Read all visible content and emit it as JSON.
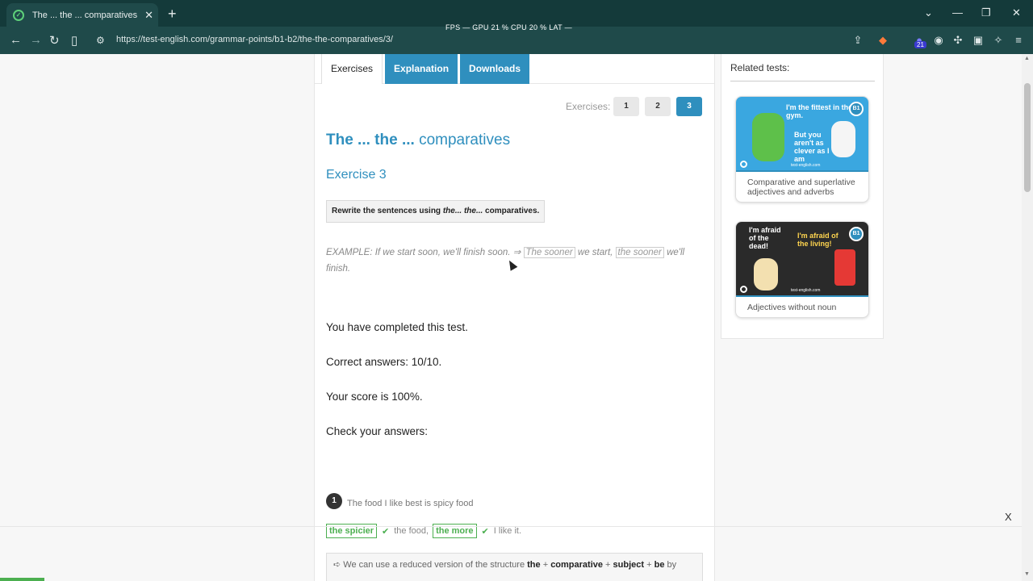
{
  "browser": {
    "tab_title": "The ... the ... comparatives - Pag",
    "tab_close": "✕",
    "new_tab": "+",
    "url": "https://test-english.com/grammar-points/b1-b2/the-the-comparatives/3/",
    "perf_overlay": "FPS  —  GPU 21 % CPU 20 % LAT  —",
    "ext_badge": "21"
  },
  "page_tabs": [
    "Exercises",
    "Explanation",
    "Downloads"
  ],
  "exercises": {
    "label": "Exercises:",
    "numbers": [
      "1",
      "2",
      "3"
    ],
    "current": "3"
  },
  "content": {
    "title_bold": "The ... the ...",
    "title_rest": " comparatives",
    "exercise_heading": "Exercise 3",
    "instruction_pre": "Rewrite the sentences using ",
    "instruction_italic": "the... the...",
    "instruction_post": " comparatives.",
    "example_pre": "EXAMPLE: If we start soon, we'll finish soon. ⇒ ",
    "example_ans1": "The sooner",
    "example_mid": " we start, ",
    "example_ans2": "the sooner",
    "example_post": " we'll finish.",
    "completed": "You have completed this test.",
    "correct": "Correct answers: 10/10.",
    "score": "Your score is 100%.",
    "check": "Check your answers:"
  },
  "question": {
    "number": "1",
    "text": "The food I like best is spicy food",
    "ans1": "the spicier",
    "mid": "the food,",
    "ans2": "the more",
    "end": "I like it.",
    "tick": "✔",
    "explain_pre": "➪ We can use a reduced version of the structure ",
    "explain_b1": "the",
    "explain_plus1": " + ",
    "explain_b2": "comparative",
    "explain_plus2": " + ",
    "explain_b3": "subject",
    "explain_plus3": " + ",
    "explain_b4": "be",
    "explain_post": " by"
  },
  "sidebar": {
    "title": "Related tests:",
    "cards": [
      {
        "caption": "Comparative and superlative adjectives and adverbs",
        "img_line1": "I'm the fittest in the gym.",
        "img_line2": "But you aren't as clever as I am",
        "badge": "B1",
        "site": "test-english.com"
      },
      {
        "caption": "Adjectives without noun",
        "img_line1": "I'm afraid of the dead!",
        "img_line2": "I'm afraid of the living!",
        "badge": "B1",
        "site": "test-english.com"
      }
    ]
  },
  "overlay": {
    "close": "X"
  },
  "colors": {
    "accent": "#2f8fbe",
    "correct": "#4caf50",
    "chrome": "#1f4a4a"
  }
}
